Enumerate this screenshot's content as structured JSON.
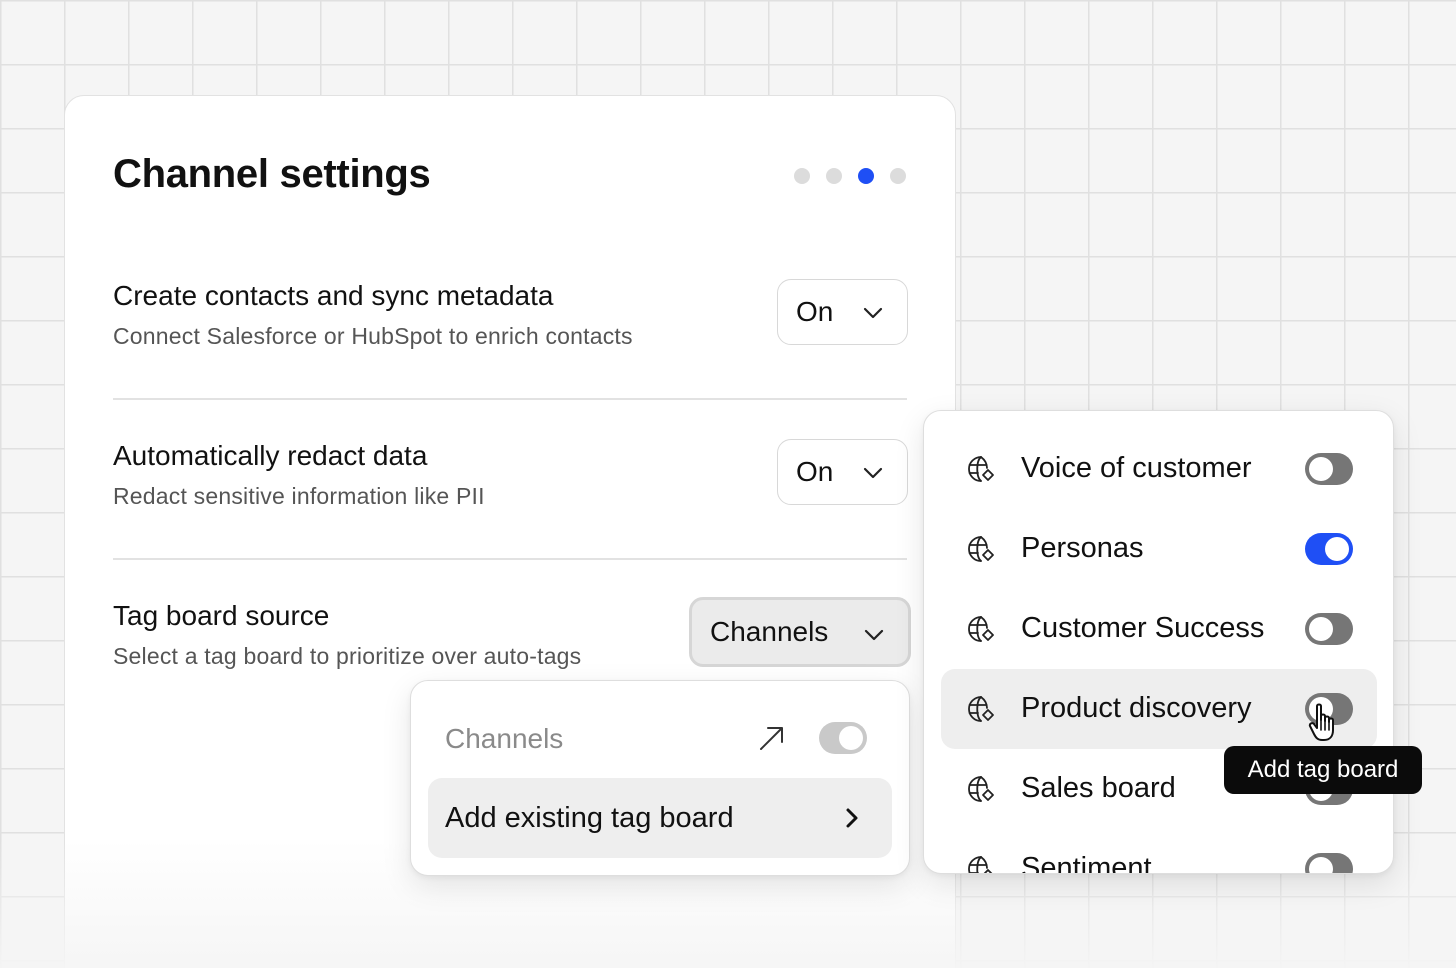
{
  "card": {
    "title": "Channel settings",
    "step_count": 4,
    "active_step": 3
  },
  "settings": [
    {
      "title": "Create contacts and sync metadata",
      "description": "Connect Salesforce or HubSpot to enrich contacts",
      "value": "On"
    },
    {
      "title": "Automatically redact data",
      "description": "Redact sensitive information like PII",
      "value": "On"
    },
    {
      "title": "Tag board source",
      "description": "Select a tag board to prioritize over auto-tags",
      "value": "Channels"
    }
  ],
  "source_menu": {
    "current_label": "Channels",
    "current_enabled": true,
    "add_existing_label": "Add existing tag board"
  },
  "tag_boards": [
    {
      "label": "Voice of customer",
      "enabled": false,
      "icon": "globe-tag-icon"
    },
    {
      "label": "Personas",
      "enabled": true,
      "icon": "globe-tag-icon"
    },
    {
      "label": "Customer Success",
      "enabled": false,
      "icon": "globe-tag-icon"
    },
    {
      "label": "Product discovery",
      "enabled": false,
      "icon": "globe-tag-icon",
      "hovered": true
    },
    {
      "label": "Sales board",
      "enabled": false,
      "icon": "globe-tag-icon"
    },
    {
      "label": "Sentiment",
      "enabled": false,
      "icon": "globe-tag-icon"
    }
  ],
  "tooltip": {
    "text": "Add tag board"
  },
  "colors": {
    "accent": "#1f4ff5",
    "toggle_off": "#767676",
    "toggle_disabled": "#c9c9c9"
  }
}
